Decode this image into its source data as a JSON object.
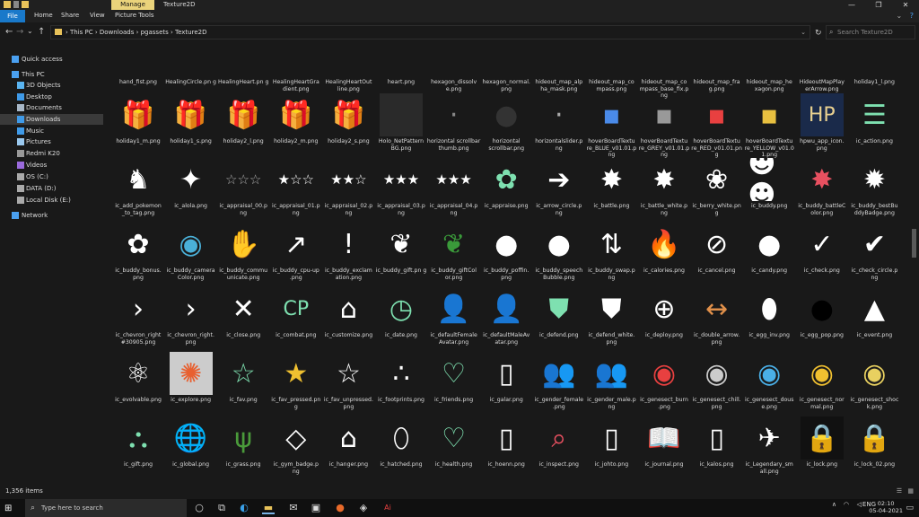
{
  "titlebar": {
    "manage_tab": "Manage",
    "title": "Texture2D",
    "minimize": "—",
    "maximize": "❐",
    "close": "✕"
  },
  "ribbon": {
    "file": "File",
    "home": "Home",
    "share": "Share",
    "view": "View",
    "picture_tools": "Picture Tools",
    "expand": "⌄",
    "help": "?"
  },
  "address": {
    "back": "←",
    "forward": "→",
    "recent": "⌄",
    "up": "↑",
    "path": "› This PC › Downloads › pgassets › Texture2D",
    "dropdown": "⌄",
    "refresh": "↻",
    "search_placeholder": "Search Texture2D"
  },
  "sidebar": {
    "items": [
      {
        "label": "Quick access",
        "icon": "star-icon",
        "color": "#4aa0f0",
        "indent": 0
      },
      {
        "label": "This PC",
        "icon": "pc-icon",
        "color": "#4aa0f0",
        "indent": 0
      },
      {
        "label": "3D Objects",
        "icon": "cube-icon",
        "color": "#5ab4f0",
        "indent": 1
      },
      {
        "label": "Desktop",
        "icon": "desktop-icon",
        "color": "#3f9ae8",
        "indent": 1
      },
      {
        "label": "Documents",
        "icon": "document-icon",
        "color": "#a8b8c8",
        "indent": 1
      },
      {
        "label": "Downloads",
        "icon": "download-icon",
        "color": "#3f9ae8",
        "indent": 1,
        "active": true
      },
      {
        "label": "Music",
        "icon": "music-icon",
        "color": "#3f9ae8",
        "indent": 1
      },
      {
        "label": "Pictures",
        "icon": "picture-icon",
        "color": "#9ac8ee",
        "indent": 1
      },
      {
        "label": "Redmi K20",
        "icon": "phone-icon",
        "color": "#999999",
        "indent": 1
      },
      {
        "label": "Videos",
        "icon": "video-icon",
        "color": "#9a6adc",
        "indent": 1
      },
      {
        "label": "OS (C:)",
        "icon": "drive-icon",
        "color": "#aaaaaa",
        "indent": 1
      },
      {
        "label": "DATA (D:)",
        "icon": "drive-icon",
        "color": "#aaaaaa",
        "indent": 1
      },
      {
        "label": "Local Disk (E:)",
        "icon": "drive-icon",
        "color": "#aaaaaa",
        "indent": 1
      },
      {
        "label": "Network",
        "icon": "network-icon",
        "color": "#4aa0f0",
        "indent": 0
      }
    ]
  },
  "files": [
    {
      "name": "hand_fist.png",
      "glyph": "",
      "color": "#ffffff",
      "bg": ""
    },
    {
      "name": "HealingCircle.pn g",
      "glyph": "",
      "color": "#ffffff",
      "bg": ""
    },
    {
      "name": "HealingHeart.pn g",
      "glyph": "",
      "color": "#ffffff",
      "bg": ""
    },
    {
      "name": "HealingHeartGra dient.png",
      "glyph": "",
      "color": "#ffffff",
      "bg": ""
    },
    {
      "name": "HealingHeartOut line.png",
      "glyph": "",
      "color": "#ffffff",
      "bg": ""
    },
    {
      "name": "heart.png",
      "glyph": "",
      "color": "#e85060",
      "bg": ""
    },
    {
      "name": "hexagon_dissolv e.png",
      "glyph": "",
      "color": "#ffffff",
      "bg": ""
    },
    {
      "name": "hexagon_normal. png",
      "glyph": "",
      "color": "#ffffff",
      "bg": ""
    },
    {
      "name": "hideout_map_alp ha_mask.png",
      "glyph": "",
      "color": "#ffffff",
      "bg": ""
    },
    {
      "name": "hideout_map_co mpass.png",
      "glyph": "",
      "color": "#8fb0c0",
      "bg": ""
    },
    {
      "name": "hideout_map_co mpass_base_fix.p ng",
      "glyph": "",
      "color": "#ffffff",
      "bg": ""
    },
    {
      "name": "hideout_map_fra g.png",
      "glyph": "",
      "color": "#ffffff",
      "bg": ""
    },
    {
      "name": "hideout_map_he xagon.png",
      "glyph": "",
      "color": "#2a8a3a",
      "bg": ""
    },
    {
      "name": "HideoutMapPlay erArrow.png",
      "glyph": "",
      "color": "#ffffff",
      "bg": ""
    },
    {
      "name": "holiday1_l.png",
      "glyph": "",
      "color": "#e85060",
      "bg": ""
    },
    {
      "name": "holiday1_m.png",
      "glyph": "🎁",
      "color": "#5ac85a",
      "bg": ""
    },
    {
      "name": "holiday1_s.png",
      "glyph": "🎁",
      "color": "#4a78e8",
      "bg": ""
    },
    {
      "name": "holiday2_l.png",
      "glyph": "🎁",
      "color": "#8a4ae0",
      "bg": ""
    },
    {
      "name": "holiday2_m.png",
      "glyph": "🎁",
      "color": "#e8c040",
      "bg": ""
    },
    {
      "name": "holiday2_s.png",
      "glyph": "🎁",
      "color": "#4ab0e8",
      "bg": ""
    },
    {
      "name": "Holo_NetPattern BG.png",
      "glyph": "",
      "color": "#555555",
      "bg": "#2a2a2a"
    },
    {
      "name": "horizontal scrollbar thumb.png",
      "glyph": "·",
      "color": "#888888",
      "bg": ""
    },
    {
      "name": "horizontal scrollbar.png",
      "glyph": "●",
      "color": "#333333",
      "bg": ""
    },
    {
      "name": "horizontalslider.p ng",
      "glyph": "·",
      "color": "#aaaaaa",
      "bg": ""
    },
    {
      "name": "hoverBoardTextu re_BLUE_v01.01.p ng",
      "glyph": "▪",
      "color": "#4a8ae8",
      "bg": ""
    },
    {
      "name": "hoverBoardTextu re_GREY_v01.01.p ng",
      "glyph": "▪",
      "color": "#999999",
      "bg": ""
    },
    {
      "name": "hoverBoardTextu re_RED_v01.01.pn g",
      "glyph": "▪",
      "color": "#e84040",
      "bg": ""
    },
    {
      "name": "hoverBoardTextu re_YELLOW_v01.0 1.png",
      "glyph": "▪",
      "color": "#e8c040",
      "bg": ""
    },
    {
      "name": "hpwu_app_icon. png",
      "glyph": "HP",
      "color": "#e8d090",
      "bg": "#1a2a4a"
    },
    {
      "name": "ic_action.png",
      "glyph": "☰",
      "color": "#7ee0b0",
      "bg": ""
    },
    {
      "name": "ic_add_pokemon _to_tag.png",
      "glyph": "♞",
      "color": "#ffffff",
      "bg": ""
    },
    {
      "name": "ic_alola.png",
      "glyph": "✦",
      "color": "#ffffff",
      "bg": ""
    },
    {
      "name": "ic_appraisal_00.p ng",
      "glyph": "☆☆☆",
      "color": "#aaaaaa",
      "bg": ""
    },
    {
      "name": "ic_appraisal_01.p ng",
      "glyph": "★☆☆",
      "color": "#ffffff",
      "bg": ""
    },
    {
      "name": "ic_appraisal_02.p ng",
      "glyph": "★★☆",
      "color": "#ffffff",
      "bg": ""
    },
    {
      "name": "ic_appraisal_03.p ng",
      "glyph": "★★★",
      "color": "#ffffff",
      "bg": ""
    },
    {
      "name": "ic_appraisal_04.p ng",
      "glyph": "★★★",
      "color": "#ffffff",
      "bg": ""
    },
    {
      "name": "ic_appraise.png",
      "glyph": "✿",
      "color": "#7ee0b0",
      "bg": ""
    },
    {
      "name": "ic_arrow_circle.p ng",
      "glyph": "➔",
      "color": "#ffffff",
      "bg": ""
    },
    {
      "name": "ic_battle.png",
      "glyph": "✸",
      "color": "#ffffff",
      "bg": ""
    },
    {
      "name": "ic_battle_white.p ng",
      "glyph": "✸",
      "color": "#ffffff",
      "bg": ""
    },
    {
      "name": "ic_berry_white.pn g",
      "glyph": "❀",
      "color": "#ffffff",
      "bg": ""
    },
    {
      "name": "ic_buddy.png",
      "glyph": "☻☻",
      "color": "#ffffff",
      "bg": ""
    },
    {
      "name": "ic_buddy_battleC olor.png",
      "glyph": "✸",
      "color": "#e85060",
      "bg": ""
    },
    {
      "name": "ic_buddy_bestBu ddyBadge.png",
      "glyph": "✹",
      "color": "#ffffff",
      "bg": ""
    },
    {
      "name": "ic_buddy_bonus. png",
      "glyph": "✿",
      "color": "#ffffff",
      "bg": ""
    },
    {
      "name": "ic_buddy_camera Color.png",
      "glyph": "◉",
      "color": "#4ab0d8",
      "bg": ""
    },
    {
      "name": "ic_buddy_commu unicate.png",
      "glyph": "✋",
      "color": "#ffffff",
      "bg": ""
    },
    {
      "name": "ic_buddy_cpu-up .png",
      "glyph": "↗",
      "color": "#ffffff",
      "bg": ""
    },
    {
      "name": "ic_buddy_exclam ation.png",
      "glyph": "!",
      "color": "#ffffff",
      "bg": ""
    },
    {
      "name": "ic_buddy_gift.pn g",
      "glyph": "❦",
      "color": "#ffffff",
      "bg": ""
    },
    {
      "name": "ic_buddy_giftCol or.png",
      "glyph": "❦",
      "color": "#3a9a3a",
      "bg": ""
    },
    {
      "name": "ic_buddy_poffin. png",
      "glyph": "●",
      "color": "#ffffff",
      "bg": ""
    },
    {
      "name": "ic_buddy_speech Bubble.png",
      "glyph": "●",
      "color": "#ffffff",
      "bg": ""
    },
    {
      "name": "ic_buddy_swap.p ng",
      "glyph": "⇅",
      "color": "#ffffff",
      "bg": ""
    },
    {
      "name": "ic_calories.png",
      "glyph": "🔥",
      "color": "#ffffff",
      "bg": ""
    },
    {
      "name": "ic_cancel.png",
      "glyph": "⊘",
      "color": "#ffffff",
      "bg": ""
    },
    {
      "name": "ic_candy.png",
      "glyph": "●",
      "color": "#ffffff",
      "bg": ""
    },
    {
      "name": "ic_check.png",
      "glyph": "✓",
      "color": "#ffffff",
      "bg": ""
    },
    {
      "name": "ic_check_circle.p ng",
      "glyph": "✔",
      "color": "#ffffff",
      "bg": ""
    },
    {
      "name": "ic_chevron_right #30905.png",
      "glyph": "›",
      "color": "#ffffff",
      "bg": ""
    },
    {
      "name": "ic_chevron_right. png",
      "glyph": "›",
      "color": "#ffffff",
      "bg": ""
    },
    {
      "name": "ic_close.png",
      "glyph": "✕",
      "color": "#ffffff",
      "bg": ""
    },
    {
      "name": "ic_combat.png",
      "glyph": "CP",
      "color": "#7ee0b0",
      "bg": ""
    },
    {
      "name": "ic_customize.png",
      "glyph": "⌂",
      "color": "#ffffff",
      "bg": ""
    },
    {
      "name": "ic_date.png",
      "glyph": "◷",
      "color": "#7ee0b0",
      "bg": ""
    },
    {
      "name": "ic_defaultFemale Avatar.png",
      "glyph": "👤",
      "color": "#d04040",
      "bg": ""
    },
    {
      "name": "ic_defaultMaleAv atar.png",
      "glyph": "👤",
      "color": "#4a8ae8",
      "bg": ""
    },
    {
      "name": "ic_defend.png",
      "glyph": "⛊",
      "color": "#7ee0b0",
      "bg": ""
    },
    {
      "name": "ic_defend_white. png",
      "glyph": "⛊",
      "color": "#ffffff",
      "bg": ""
    },
    {
      "name": "ic_deploy.png",
      "glyph": "⊕",
      "color": "#ffffff",
      "bg": ""
    },
    {
      "name": "ic_double_arrow. png",
      "glyph": "↔",
      "color": "#e0904a",
      "bg": ""
    },
    {
      "name": "ic_egg_inv.png",
      "glyph": "⬮",
      "color": "#ffffff",
      "bg": ""
    },
    {
      "name": "ic_egg_pop.png",
      "glyph": "●",
      "color": "#000000",
      "bg": ""
    },
    {
      "name": "ic_event.png",
      "glyph": "▲",
      "color": "#ffffff",
      "bg": ""
    },
    {
      "name": "ic_evolvable.png",
      "glyph": "⚛",
      "color": "#ffffff",
      "bg": ""
    },
    {
      "name": "ic_explore.png",
      "glyph": "✺",
      "color": "#e86030",
      "bg": "#cccccc"
    },
    {
      "name": "ic_fav.png",
      "glyph": "☆",
      "color": "#7ee0b0",
      "bg": ""
    },
    {
      "name": "ic_fav_pressed.pn g",
      "glyph": "★",
      "color": "#f0c030",
      "bg": ""
    },
    {
      "name": "ic_fav_unpressed. png",
      "glyph": "☆",
      "color": "#ffffff",
      "bg": ""
    },
    {
      "name": "ic_footprints.png",
      "glyph": "∴",
      "color": "#ffffff",
      "bg": ""
    },
    {
      "name": "ic_friends.png",
      "glyph": "♡",
      "color": "#7ee0b0",
      "bg": ""
    },
    {
      "name": "ic_galar.png",
      "glyph": "▯",
      "color": "#ffffff",
      "bg": ""
    },
    {
      "name": "ic_gender_female .png",
      "glyph": "👥",
      "color": "#ffffff",
      "bg": ""
    },
    {
      "name": "ic_gender_male.p ng",
      "glyph": "👥",
      "color": "#4a8aa8",
      "bg": ""
    },
    {
      "name": "ic_genesect_burn .png",
      "glyph": "◉",
      "color": "#e84040",
      "bg": ""
    },
    {
      "name": "ic_genesect_chill. png",
      "glyph": "◉",
      "color": "#cccccc",
      "bg": ""
    },
    {
      "name": "ic_genesect_dous e.png",
      "glyph": "◉",
      "color": "#4ab0e8",
      "bg": ""
    },
    {
      "name": "ic_genesect_nor mal.png",
      "glyph": "◉",
      "color": "#f0c030",
      "bg": ""
    },
    {
      "name": "ic_genesect_shoc k.png",
      "glyph": "◉",
      "color": "#e8d060",
      "bg": ""
    },
    {
      "name": "ic_gift.png",
      "glyph": "⛬",
      "color": "#7ee0b0",
      "bg": ""
    },
    {
      "name": "ic_global.png",
      "glyph": "🌐",
      "color": "#ffffff",
      "bg": ""
    },
    {
      "name": "ic_grass.png",
      "glyph": "ψ",
      "color": "#4a9a3a",
      "bg": ""
    },
    {
      "name": "ic_gym_badge.p ng",
      "glyph": "◇",
      "color": "#ffffff",
      "bg": ""
    },
    {
      "name": "ic_hanger.png",
      "glyph": "⌂",
      "color": "#ffffff",
      "bg": ""
    },
    {
      "name": "ic_hatched.png",
      "glyph": "⬯",
      "color": "#ffffff",
      "bg": ""
    },
    {
      "name": "ic_health.png",
      "glyph": "♡",
      "color": "#7ee0b0",
      "bg": ""
    },
    {
      "name": "ic_hoenn.png",
      "glyph": "▯",
      "color": "#ffffff",
      "bg": ""
    },
    {
      "name": "ic_inspect.png",
      "glyph": "⌕",
      "color": "#e85060",
      "bg": ""
    },
    {
      "name": "ic_johto.png",
      "glyph": "▯",
      "color": "#ffffff",
      "bg": ""
    },
    {
      "name": "ic_journal.png",
      "glyph": "📖",
      "color": "#ffffff",
      "bg": ""
    },
    {
      "name": "ic_kalos.png",
      "glyph": "▯",
      "color": "#ffffff",
      "bg": ""
    },
    {
      "name": "ic_Legendary_sm all.png",
      "glyph": "✈",
      "color": "#ffffff",
      "bg": ""
    },
    {
      "name": "ic_lock.png",
      "glyph": "🔒",
      "color": "#ffffff",
      "bg": "#111111"
    },
    {
      "name": "ic_lock_02.png",
      "glyph": "🔒",
      "color": "#ffffff",
      "bg": ""
    }
  ],
  "status": {
    "count": "1,356 items"
  },
  "taskbar": {
    "search_placeholder": "Type here to search",
    "lang": "ENG",
    "time": "02:10",
    "date": "05-04-2021"
  }
}
